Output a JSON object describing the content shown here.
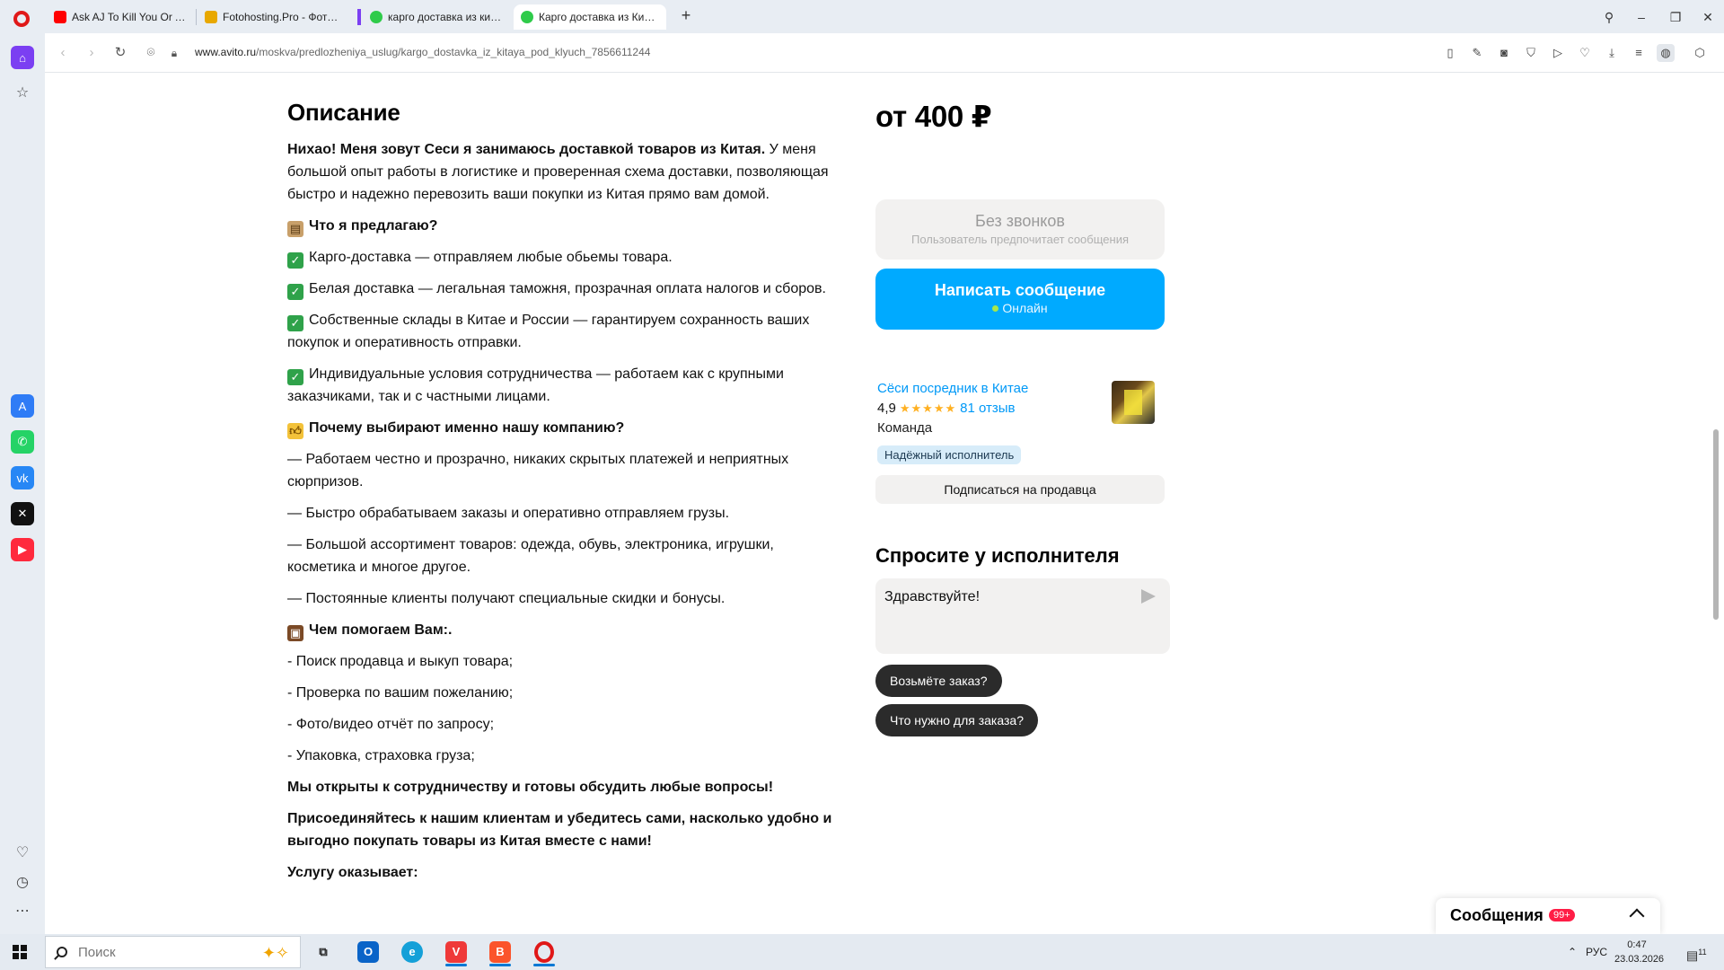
{
  "browser": {
    "tabs": [
      {
        "title": "Ask AJ To Kill You Or Ask",
        "favicon_color": "#ff0000"
      },
      {
        "title": "Fotohosting.Pro - Фотохо",
        "favicon_color": "#e8a800"
      },
      {
        "title": "карго доставка из китая",
        "favicon_color": "#2fcb4a"
      },
      {
        "title": "Карго доставка из Китая",
        "favicon_color": "#2fcb4a"
      }
    ],
    "url_host": "www.avito.ru",
    "url_path": "/moskva/predlozheniya_uslug/kargo_dostavka_iz_kitaya_pod_klyuch_7856611244"
  },
  "listing": {
    "description_heading": "Описание",
    "intro_bold": "Нихао! Меня зовут Сеси я занимаюсь доставкой товаров из Китая.",
    "intro_rest": " У меня большой опыт работы в логистике и проверенная схема доставки, позволяющая быстро и надежно перевозить ваши покупки из Китая прямо вам домой.",
    "offer_heading": "Что я предлагаю?",
    "offers": [
      "Карго-доставка — отправляем любые обьемы товара.",
      "Белая доставка — легальная таможня, прозрачная оплата налогов и сборов.",
      "Собственные склады в Китае и России — гарантируем сохранность ваших покупок и оперативность отправки.",
      "Индивидуальные условия сотрудничества — работаем как с крупными заказчиками, так и с частными лицами."
    ],
    "why_heading": "Почему выбирают именно нашу компанию?",
    "reasons": [
      "— Работаем честно и прозрачно, никаких скрытых платежей и неприятных сюрпризов.",
      "— Быстро обрабатываем заказы и оперативно отправляем грузы.",
      "— Большой ассортимент товаров: одежда, обувь, электроника, игрушки, косметика и многое другое.",
      "— Постоянные клиенты получают специальные скидки и бонусы."
    ],
    "help_heading": "Чем помогаем Вам:.",
    "helps": [
      "- Поиск продавца и выкуп товара;",
      "- Проверка по вашим пожеланию;",
      "- Фото/видео отчёт по запросу;",
      "- Упаковка, страховка груза;"
    ],
    "closing_1": "Мы открыты к сотрудничеству и готовы обсудить любые вопросы!",
    "closing_2": "Присоединяйтесь к нашим клиентам и убедитесь сами, насколько удобно и выгодно покупать товары из Китая вместе с нами!",
    "service_by": "Услугу оказывает:"
  },
  "sidebar": {
    "price": "от 400 ₽",
    "no_calls": "Без звонков",
    "no_calls_note": "Пользователь предпочитает сообщения",
    "write_message": "Написать сообщение",
    "online": "Онлайн",
    "seller_name": "Сёси посредник в Китае",
    "rating": "4,9",
    "stars": "★★★★★",
    "reviews": "81 отзыв",
    "seller_type": "Команда",
    "badge": "Надёжный исполнитель",
    "subscribe": "Подписаться на продавца",
    "ask_title": "Спросите у исполнителя",
    "ask_value": "Здравствуйте!",
    "quick_replies": [
      "Возьмёте заказ?",
      "Что нужно для заказа?"
    ]
  },
  "messages_panel": {
    "label": "Сообщения",
    "count": "99+"
  },
  "taskbar": {
    "search_placeholder": "Поиск",
    "lang": "РУС",
    "time": "0:47",
    "date": "23.03.2026",
    "notifications": "11"
  },
  "colors": {
    "accent": "#00aaff",
    "link": "#0099f7",
    "star": "#ffb021",
    "badge_bg": "#d7ecf9",
    "chip_bg": "#2b2b2b",
    "counter": "#ff1d46",
    "opera": "#e01818"
  }
}
